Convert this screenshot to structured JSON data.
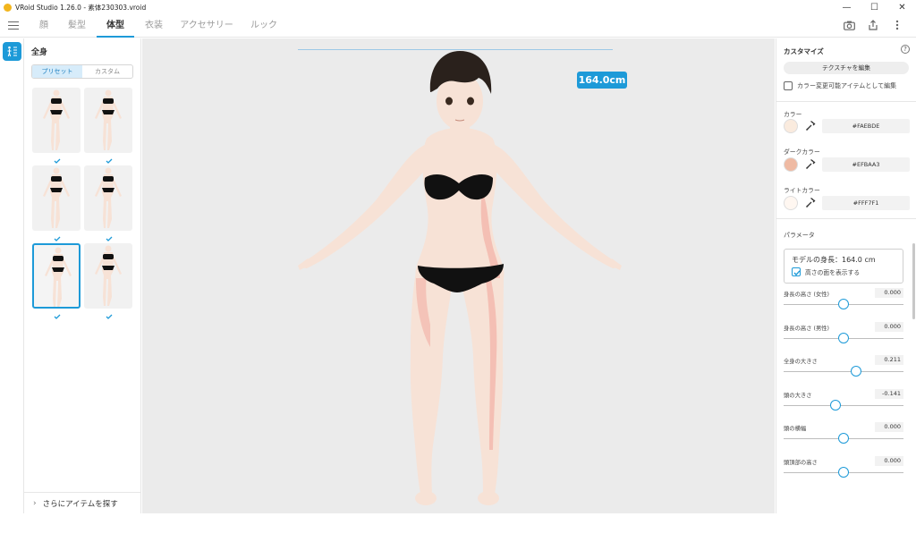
{
  "window": {
    "title": "VRoid Studio 1.26.0 - 素体230303.vroid",
    "controls": [
      "—",
      "☐",
      "✕"
    ]
  },
  "nav": {
    "tabs": [
      {
        "label": "顔",
        "active": false
      },
      {
        "label": "髪型",
        "active": false
      },
      {
        "label": "体型",
        "active": true
      },
      {
        "label": "衣装",
        "active": false
      },
      {
        "label": "アクセサリー",
        "active": false
      },
      {
        "label": "ルック",
        "active": false
      }
    ],
    "icons": [
      "hamburger-icon",
      "camera-icon",
      "export-icon",
      "more-vertical-icon"
    ]
  },
  "tool": {
    "icon": "body-adjust-icon"
  },
  "left_panel": {
    "title": "全身",
    "segment": {
      "preset": "プリセット",
      "custom": "カスタム",
      "selected": "preset"
    },
    "presets": [
      {
        "checked": true,
        "selected": false
      },
      {
        "checked": true,
        "selected": false
      },
      {
        "checked": true,
        "selected": false
      },
      {
        "checked": true,
        "selected": false
      },
      {
        "checked": true,
        "selected": true
      },
      {
        "checked": true,
        "selected": false
      }
    ],
    "more_items": "さらにアイテムを探す"
  },
  "viewport": {
    "height_badge": "164.0cm"
  },
  "right_panel": {
    "title": "カスタマイズ",
    "edit_texture": "テクスチャを編集",
    "color_changeable_label": "カラー変更可能アイテムとして編集",
    "color_changeable_checked": false,
    "colors": [
      {
        "label": "カラー",
        "hex": "#FAEBDE",
        "swatch": "#FAEBDE"
      },
      {
        "label": "ダークカラー",
        "hex": "#EFBAA3",
        "swatch": "#EFBAA3"
      },
      {
        "label": "ライトカラー",
        "hex": "#FFF7F1",
        "swatch": "#FFF7F1"
      }
    ],
    "params_title": "パラメータ",
    "model_height": "モデルの身長：164.0 cm",
    "show_height_plane": "高さの面を表示する",
    "show_height_plane_checked": true,
    "sliders": [
      {
        "label": "身長の高さ (女性)",
        "value": "0.000",
        "fraction": 0.5
      },
      {
        "label": "身長の高さ (男性)",
        "value": "0.000",
        "fraction": 0.5
      },
      {
        "label": "全身の大きさ",
        "value": "0.211",
        "fraction": 0.605
      },
      {
        "label": "頭の大きさ",
        "value": "-0.141",
        "fraction": 0.43
      },
      {
        "label": "頭の横幅",
        "value": "0.000",
        "fraction": 0.5
      },
      {
        "label": "頭頂部の高さ",
        "value": "0.000",
        "fraction": 0.5
      }
    ]
  },
  "colors": {
    "accent": "#1D9AD8",
    "skin": "#FAEBDE",
    "skin_shadow": "#EFBAA3",
    "garment": "#111111",
    "hair": "#2a211c"
  }
}
